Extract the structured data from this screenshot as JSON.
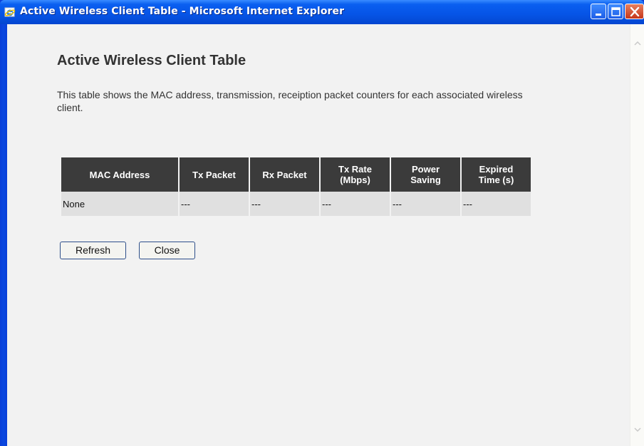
{
  "window": {
    "title": "Active Wireless Client Table - Microsoft Internet Explorer",
    "controls": {
      "minimize": "minimize",
      "maximize": "maximize",
      "close": "close"
    }
  },
  "page": {
    "heading": "Active Wireless Client Table",
    "description": "This table shows the MAC address, transmission, receiption packet counters for each associated wireless client."
  },
  "table": {
    "headers": {
      "mac": "MAC Address",
      "tx": "Tx Packet",
      "rx": "Rx Packet",
      "rate_line1": "Tx Rate",
      "rate_line2": "(Mbps)",
      "power_line1": "Power",
      "power_line2": "Saving",
      "expired_line1": "Expired",
      "expired_line2": "Time (s)"
    },
    "rows": [
      {
        "mac": "None",
        "tx": "---",
        "rx": "---",
        "rate": "---",
        "power": "---",
        "expired": "---"
      }
    ]
  },
  "buttons": {
    "refresh": "Refresh",
    "close": "Close"
  },
  "colors": {
    "titlebar": "#0654e6",
    "header_bg": "#3b3b3b",
    "row_bg": "#e0e0e0",
    "page_bg": "#f2f2f2"
  }
}
